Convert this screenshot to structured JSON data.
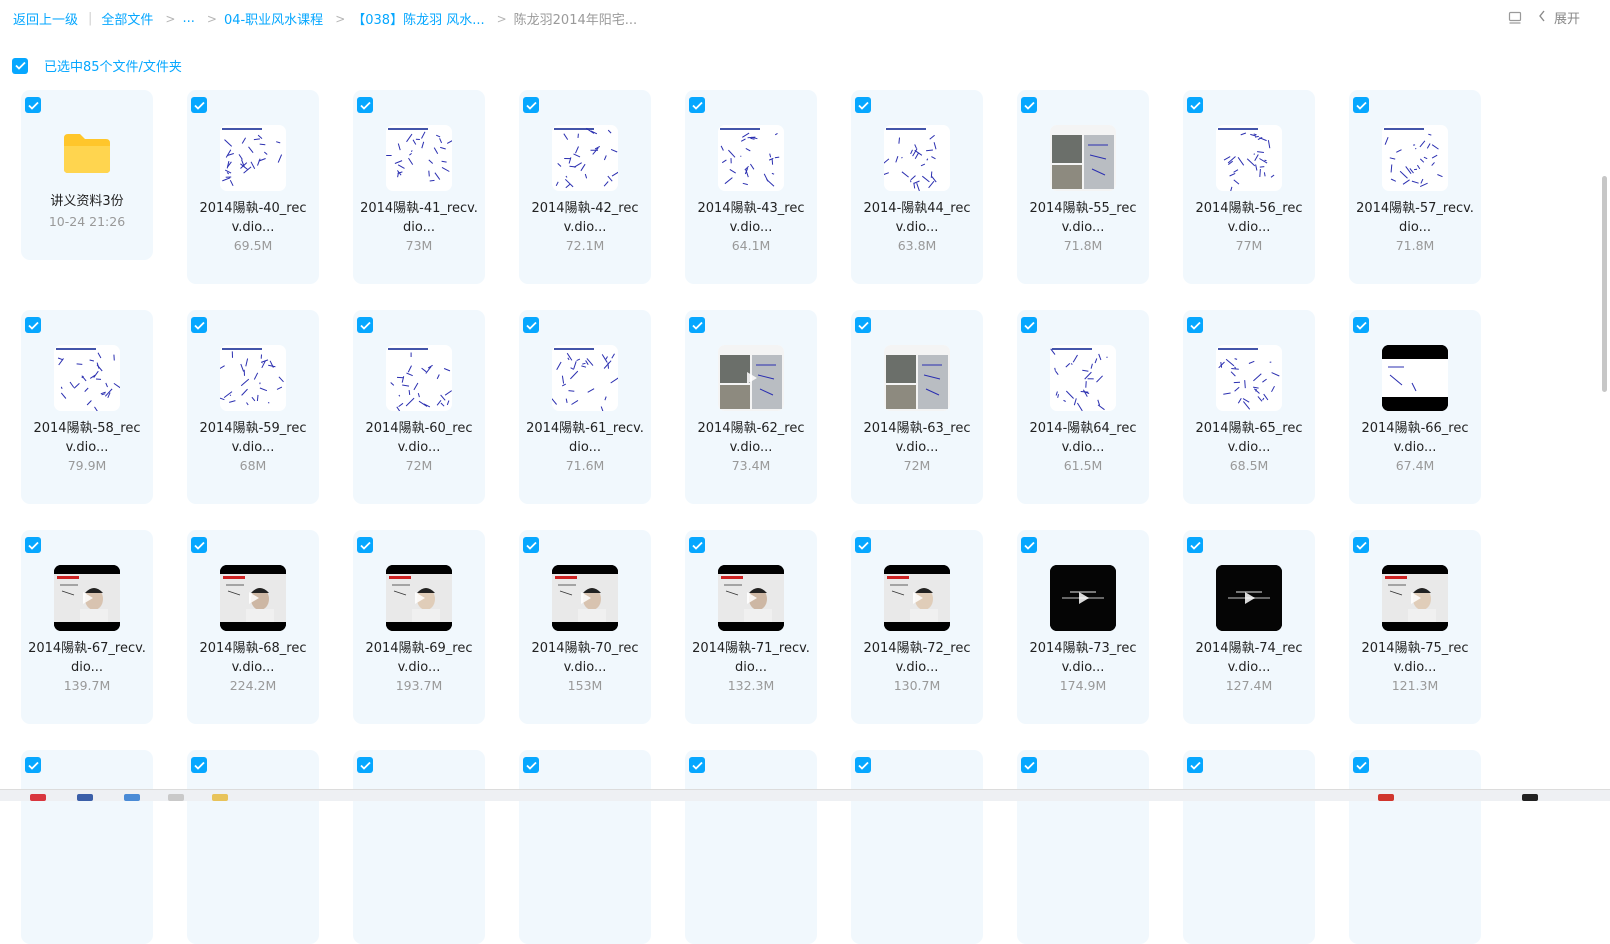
{
  "breadcrumb": {
    "back": "返回上一级",
    "all_files": "全部文件",
    "ellipsis": "...",
    "folder1": "04-职业风水课程",
    "folder2": "【038】陈龙羽 风水...",
    "current": "陈龙羽2014年阳宅..."
  },
  "toolbar": {
    "expand_label": "展开",
    "list_icon": "list-view-icon",
    "chevron_icon": "chevron-left-icon"
  },
  "selection": {
    "label": "已选中85个文件/文件夹",
    "checked": true
  },
  "colors": {
    "accent": "#06a7ff",
    "tile_bg": "#f1f8fd",
    "folder": "#ffc62b"
  },
  "files": [
    {
      "name_l1": "讲义资料3份",
      "name_l2": "",
      "size": "10-24 21:26",
      "kind": "folder"
    },
    {
      "name_l1": "2014陽執-40_rec",
      "name_l2": "v.dio...",
      "size": "69.5M",
      "kind": "doc"
    },
    {
      "name_l1": "2014陽執-41_recv.",
      "name_l2": "dio...",
      "size": "73M",
      "kind": "doc"
    },
    {
      "name_l1": "2014陽執-42_rec",
      "name_l2": "v.dio...",
      "size": "72.1M",
      "kind": "doc"
    },
    {
      "name_l1": "2014陽執-43_rec",
      "name_l2": "v.dio...",
      "size": "64.1M",
      "kind": "doc"
    },
    {
      "name_l1": "2014-陽執44_rec",
      "name_l2": "v.dio...",
      "size": "63.8M",
      "kind": "doc"
    },
    {
      "name_l1": "2014陽執-55_rec",
      "name_l2": "v.dio...",
      "size": "71.8M",
      "kind": "photo"
    },
    {
      "name_l1": "2014陽執-56_rec",
      "name_l2": "v.dio...",
      "size": "77M",
      "kind": "doc"
    },
    {
      "name_l1": "2014陽執-57_recv.",
      "name_l2": "dio...",
      "size": "71.8M",
      "kind": "doc"
    },
    {
      "name_l1": "2014陽執-58_rec",
      "name_l2": "v.dio...",
      "size": "79.9M",
      "kind": "doc"
    },
    {
      "name_l1": "2014陽執-59_rec",
      "name_l2": "v.dio...",
      "size": "68M",
      "kind": "doc"
    },
    {
      "name_l1": "2014陽執-60_rec",
      "name_l2": "v.dio...",
      "size": "72M",
      "kind": "doc"
    },
    {
      "name_l1": "2014陽執-61_recv.",
      "name_l2": "dio...",
      "size": "71.6M",
      "kind": "doc"
    },
    {
      "name_l1": "2014陽執-62_rec",
      "name_l2": "v.dio...",
      "size": "73.4M",
      "kind": "photo-play"
    },
    {
      "name_l1": "2014陽執-63_rec",
      "name_l2": "v.dio...",
      "size": "72M",
      "kind": "photo"
    },
    {
      "name_l1": "2014-陽執64_rec",
      "name_l2": "v.dio...",
      "size": "61.5M",
      "kind": "doc"
    },
    {
      "name_l1": "2014陽執-65_rec",
      "name_l2": "v.dio...",
      "size": "68.5M",
      "kind": "doc"
    },
    {
      "name_l1": "2014陽執-66_rec",
      "name_l2": "v.dio...",
      "size": "67.4M",
      "kind": "letterbox"
    },
    {
      "name_l1": "2014陽執-67_recv.",
      "name_l2": "dio...",
      "size": "139.7M",
      "kind": "video"
    },
    {
      "name_l1": "2014陽執-68_rec",
      "name_l2": "v.dio...",
      "size": "224.2M",
      "kind": "video"
    },
    {
      "name_l1": "2014陽執-69_rec",
      "name_l2": "v.dio...",
      "size": "193.7M",
      "kind": "video"
    },
    {
      "name_l1": "2014陽執-70_rec",
      "name_l2": "v.dio...",
      "size": "153M",
      "kind": "video"
    },
    {
      "name_l1": "2014陽執-71_recv.",
      "name_l2": "dio...",
      "size": "132.3M",
      "kind": "video"
    },
    {
      "name_l1": "2014陽執-72_rec",
      "name_l2": "v.dio...",
      "size": "130.7M",
      "kind": "video"
    },
    {
      "name_l1": "2014陽執-73_rec",
      "name_l2": "v.dio...",
      "size": "174.9M",
      "kind": "dark"
    },
    {
      "name_l1": "2014陽執-74_rec",
      "name_l2": "v.dio...",
      "size": "127.4M",
      "kind": "dark"
    },
    {
      "name_l1": "2014陽執-75_rec",
      "name_l2": "v.dio...",
      "size": "121.3M",
      "kind": "video"
    },
    {
      "name_l1": "",
      "name_l2": "",
      "size": "",
      "kind": "partial"
    },
    {
      "name_l1": "",
      "name_l2": "",
      "size": "",
      "kind": "partial"
    },
    {
      "name_l1": "",
      "name_l2": "",
      "size": "",
      "kind": "partial"
    },
    {
      "name_l1": "",
      "name_l2": "",
      "size": "",
      "kind": "partial"
    },
    {
      "name_l1": "",
      "name_l2": "",
      "size": "",
      "kind": "partial"
    },
    {
      "name_l1": "",
      "name_l2": "",
      "size": "",
      "kind": "partial"
    },
    {
      "name_l1": "",
      "name_l2": "",
      "size": "",
      "kind": "partial"
    },
    {
      "name_l1": "",
      "name_l2": "",
      "size": "",
      "kind": "partial"
    },
    {
      "name_l1": "",
      "name_l2": "",
      "size": "",
      "kind": "partial"
    }
  ]
}
